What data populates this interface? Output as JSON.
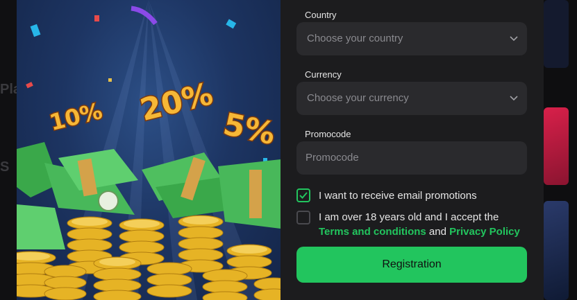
{
  "background": {
    "left_fragments": [
      "Pla",
      "S"
    ]
  },
  "form": {
    "country": {
      "label": "Country",
      "placeholder": "Choose your country"
    },
    "currency": {
      "label": "Currency",
      "placeholder": "Choose your currency"
    },
    "promocode": {
      "label": "Promocode",
      "placeholder": "Promocode"
    },
    "email_promotions": {
      "label": "I want to receive email promotions",
      "checked": true
    },
    "age_terms": {
      "text_before": "I am over 18 years old and I accept the",
      "terms_link": "Terms and conditions",
      "conjunction": "and",
      "privacy_link": "Privacy Policy",
      "checked": false
    },
    "submit_label": "Registration"
  },
  "promo_art": {
    "badges": [
      "10%",
      "20%",
      "5%"
    ]
  },
  "colors": {
    "accent": "#22c55e",
    "modal_bg": "#1c1c1e",
    "field_bg": "#2a2a2d"
  }
}
